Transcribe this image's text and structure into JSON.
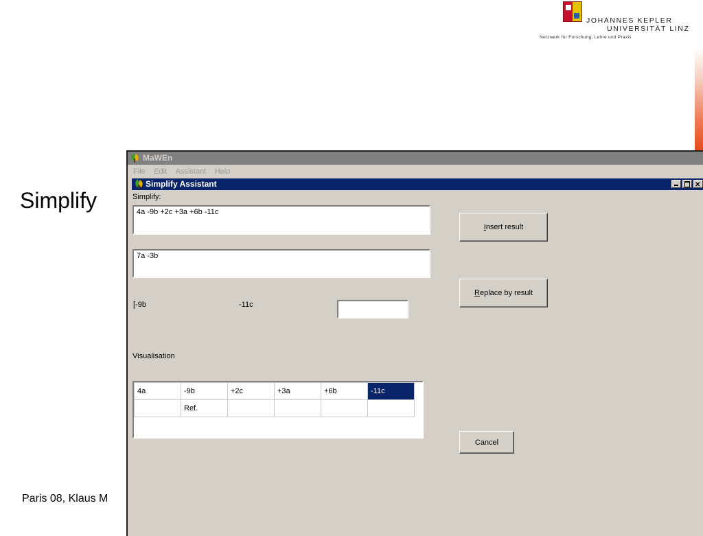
{
  "logo": {
    "line1": "JOHANNES KEPLER",
    "line2": "UNIVERSITÄT LINZ",
    "line3": "Netzwerk für Forschung, Lehre und Praxis"
  },
  "slide": {
    "title": "Simplify",
    "footer": "Paris 08, Klaus M"
  },
  "app": {
    "title": "MaWEn",
    "menu": [
      "File",
      "Edit",
      "Assistant",
      "Help"
    ]
  },
  "dialog": {
    "title": "Simplify Assistant",
    "simplify_label": "Simplify:",
    "input_expression": "4a -9b +2c +3a +6b -11c",
    "result_expression": "7a -3b",
    "term_left": "[-9b",
    "term_mid": "-11c",
    "small_input_value": "",
    "visualisation_label": "Visualisation",
    "buttons": {
      "insert_prefix": "I",
      "insert_rest": "nsert result",
      "replace_prefix": "R",
      "replace_rest": "eplace by result",
      "cancel": "Cancel"
    },
    "grid": {
      "row1": [
        "4a",
        "-9b",
        "+2c",
        "+3a",
        "+6b",
        "-11c"
      ],
      "row2": [
        "",
        "Ref.",
        "",
        "",
        "",
        ""
      ],
      "selected_index": 5
    }
  },
  "colors": {
    "dialog_title_bg": "#0a246a",
    "app_title_bg": "#808080",
    "window_bg": "#d4d0c8",
    "selected_cell": "#0a246a"
  }
}
